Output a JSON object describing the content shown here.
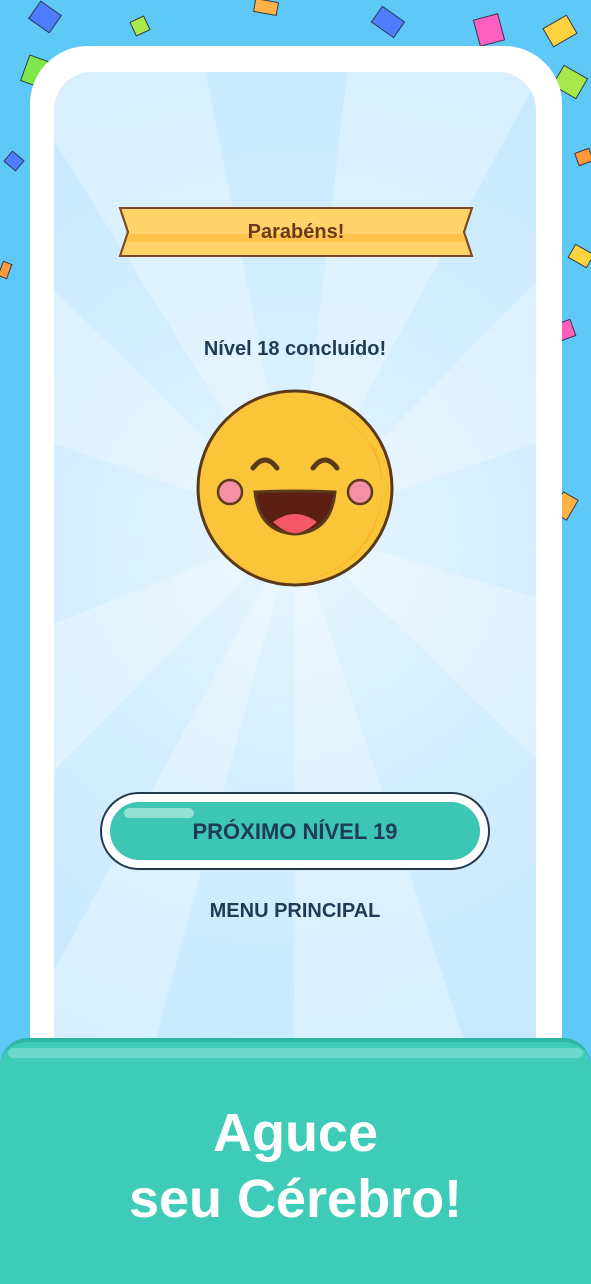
{
  "banner": {
    "title": "Parabéns!"
  },
  "level": {
    "completed_text": "Nível 18 concluído!"
  },
  "buttons": {
    "next_level": "PRÓXIMO NÍVEL 19",
    "main_menu": "MENU PRINCIPAL"
  },
  "promo": {
    "line1": "Aguce",
    "line2": "seu Cérebro!"
  },
  "icons": {
    "mascot": "happy-smiley-face-icon",
    "decoration": "confetti"
  },
  "colors": {
    "background": "#5ec8f7",
    "screen": "#d3eeff",
    "banner": "#ffd36a",
    "button": "#3cc6b3",
    "bottom_panel": "#3ecbb8",
    "text_dark": "#1f3b57",
    "smiley": "#fbc53a"
  }
}
